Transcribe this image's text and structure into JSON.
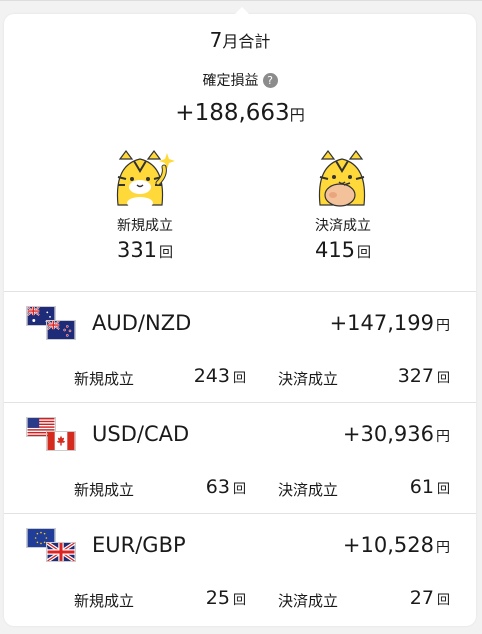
{
  "summary": {
    "month_num": "7",
    "month_suffix": "月合計",
    "pl_label": "確定損益",
    "help_icon": "?",
    "pl_value": "+188,663",
    "yen": "円",
    "new_label": "新規成立",
    "new_count": "331",
    "settle_label": "決済成立",
    "settle_count": "415",
    "kai": "回"
  },
  "pairs": [
    {
      "name": "AUD/NZD",
      "pl": "+147,199",
      "yen": "円",
      "new_label": "新規成立",
      "new_count": "243",
      "settle_label": "決済成立",
      "settle_count": "327",
      "kai": "回",
      "flags": [
        "australia-flag-icon",
        "new-zealand-flag-icon"
      ]
    },
    {
      "name": "USD/CAD",
      "pl": "+30,936",
      "yen": "円",
      "new_label": "新規成立",
      "new_count": "63",
      "settle_label": "決済成立",
      "settle_count": "61",
      "kai": "回",
      "flags": [
        "usa-flag-icon",
        "canada-flag-icon"
      ]
    },
    {
      "name": "EUR/GBP",
      "pl": "+10,528",
      "yen": "円",
      "new_label": "新規成立",
      "new_count": "25",
      "settle_label": "決済成立",
      "settle_count": "27",
      "kai": "回",
      "flags": [
        "eu-flag-icon",
        "uk-flag-icon"
      ]
    }
  ],
  "colors": {
    "tiger_yellow": "#ffd93a",
    "positive_text": "#1a1a1a",
    "divider": "#e2e2e2"
  }
}
